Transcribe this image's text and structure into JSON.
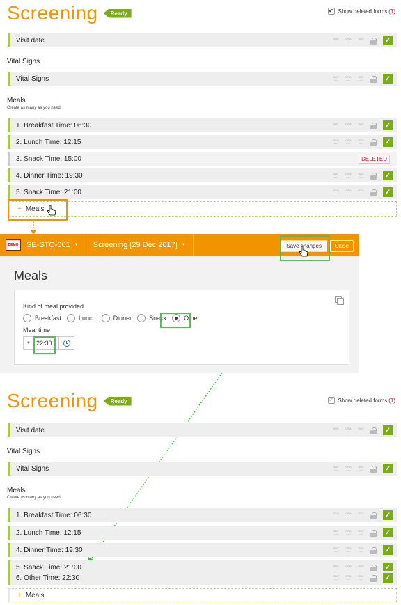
{
  "top_panel": {
    "title": "Screening",
    "status_badge": "Ready",
    "show_deleted_label": "Show deleted forms",
    "show_deleted_count": "(1)",
    "rows": [
      {
        "label": "Visit date",
        "checked": true
      }
    ],
    "vital_signs_section": "Vital Signs",
    "vital_signs_row": "Vital Signs",
    "meals_section": "Meals",
    "meals_sub": "Create as many as you need",
    "meal_rows": [
      {
        "label": "1. Breakfast Time: 06:30",
        "deleted": false
      },
      {
        "label": "2. Lunch Time: 12:15",
        "deleted": false
      },
      {
        "label": "3. Snack Time: 15:00",
        "deleted": true
      },
      {
        "label": "4. Dinner Time: 19:30",
        "deleted": false
      },
      {
        "label": "5. Snack Time: 21:00",
        "deleted": false
      }
    ],
    "deleted_tag": "DELETED",
    "add_label": "Meals"
  },
  "form": {
    "demo_badge": "DEMO",
    "subject": "SE-STO-001",
    "event": "Screening [29 Dec 2017]",
    "save_label": "Save changes",
    "close_label": "Close",
    "title": "Meals",
    "kind_label": "Kind of meal provided",
    "options": [
      "Breakfast",
      "Lunch",
      "Dinner",
      "Snack",
      "Other"
    ],
    "selected_option": "Other",
    "time_label": "Meal time",
    "time_value": "22:30"
  },
  "bottom_panel": {
    "title": "Screening",
    "status_badge": "Ready",
    "show_deleted_label": "Show deleted forms",
    "show_deleted_count": "(1)",
    "visit_row": "Visit date",
    "vital_signs_section": "Vital Signs",
    "vital_signs_row": "Vital Signs",
    "meals_section": "Meals",
    "meals_sub": "Create as many as you need",
    "meal_rows": [
      "1. Breakfast Time: 06:30",
      "2. Lunch Time: 12:15",
      "4. Dinner Time: 19:30",
      "5. Snack Time: 21:00",
      "6. Other Time: 22:30"
    ],
    "add_label": "Meals"
  },
  "mini_status": [
    "SDV",
    "CRA",
    "SDV"
  ],
  "colors": {
    "brand_orange": "#f29400",
    "ready_green": "#7aac16",
    "row_accent": "#a6c84a",
    "highlight_green": "#5cb85c",
    "deleted_red": "#d0021b",
    "connector_green": "#3cb43c"
  },
  "icons": [
    "check-icon",
    "lock-icon",
    "copy-icon",
    "clock-icon",
    "hand-cursor-icon",
    "plus-icon",
    "caret-down-icon"
  ]
}
